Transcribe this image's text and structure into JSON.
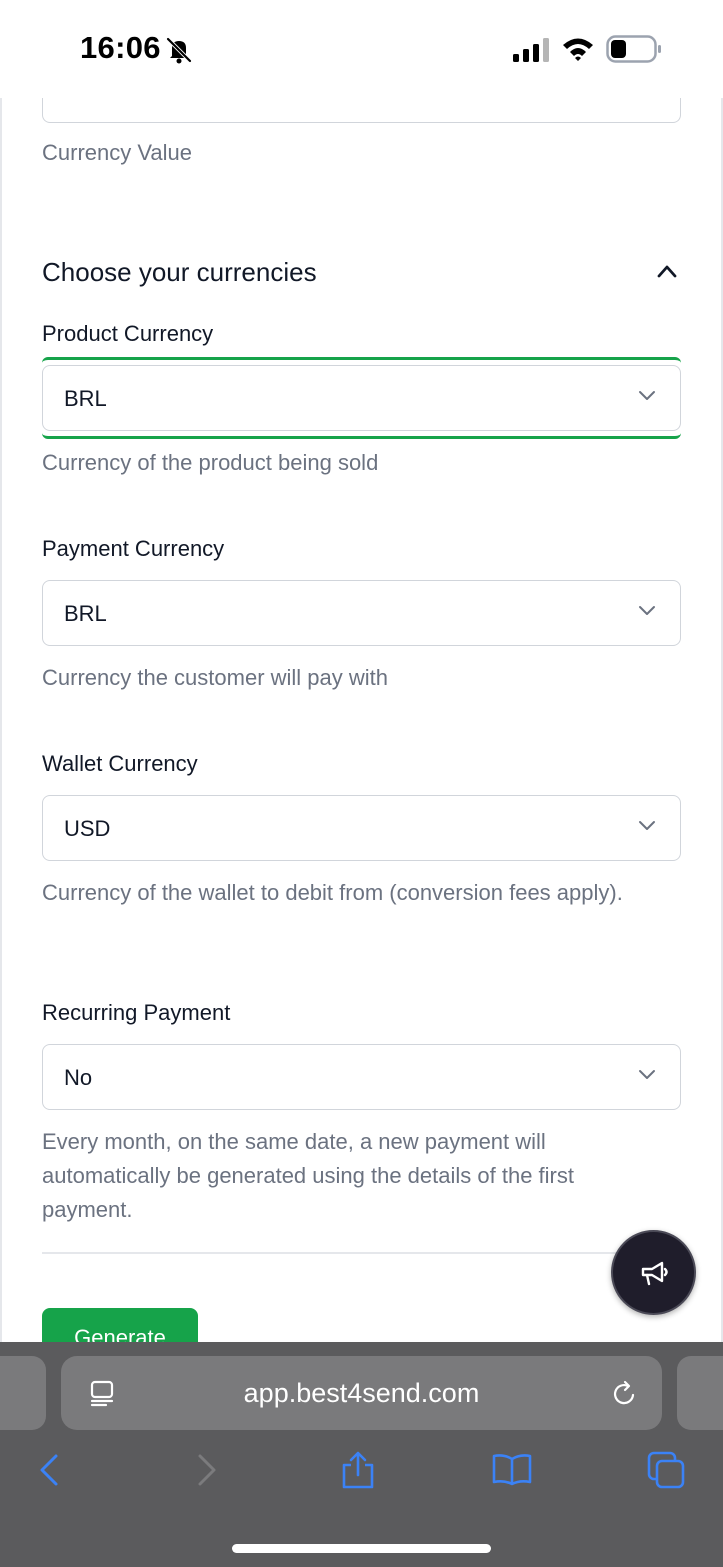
{
  "status_bar": {
    "time": "16:06"
  },
  "form": {
    "currency_value_help": "Currency Value",
    "section_title": "Choose your currencies",
    "product_currency": {
      "label": "Product Currency",
      "value": "BRL",
      "help": "Currency of the product being sold"
    },
    "payment_currency": {
      "label": "Payment Currency",
      "value": "BRL",
      "help": "Currency the customer will pay with"
    },
    "wallet_currency": {
      "label": "Wallet Currency",
      "value": "USD",
      "help": "Currency of the wallet to debit from (conversion fees apply)."
    },
    "recurring_payment": {
      "label": "Recurring Payment",
      "value": "No",
      "help": "Every month, on the same date, a new payment will automatically be generated using the details of the first payment."
    },
    "generate_label": "Generate"
  },
  "browser": {
    "url": "app.best4send.com"
  },
  "colors": {
    "accent": "#16a34a",
    "fab": "#1f1d2b",
    "safari_bar": "#5b5b5d",
    "ios_blue": "#3b82f6"
  },
  "icons": [
    "bell-slash-icon",
    "signal-icon",
    "wifi-icon",
    "battery-icon",
    "chevron-up-icon",
    "chevron-down-icon",
    "megaphone-icon",
    "reader-icon",
    "reload-icon",
    "back-icon",
    "forward-icon",
    "share-icon",
    "bookmarks-icon",
    "tabs-icon"
  ]
}
